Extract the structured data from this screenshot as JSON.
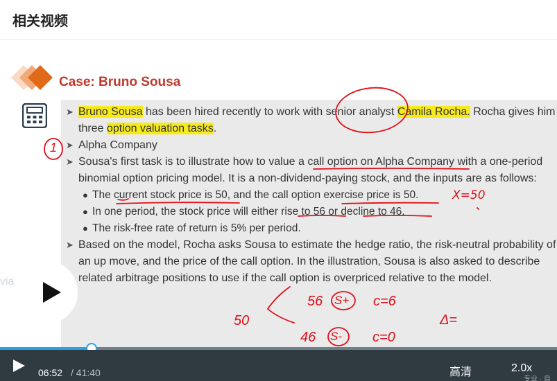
{
  "header": {
    "title": "相关视频"
  },
  "slide": {
    "title": "Case: Bruno Sousa",
    "lines": {
      "l1_hl1": "Bruno Sousa",
      "l1_mid": " has been hired recently to work with senior analyst ",
      "l1_hl2": "Camila Rocha.",
      "l1_end": " Rocha gives him",
      "l2_pre": "three ",
      "l2_hl": "option valuation tasks",
      "l2_end": ".",
      "l3": "Alpha Company",
      "l4": "Sousa's first task is to illustrate how to value a call option on Alpha Company with a one-period",
      "l5": "binomial option pricing model. It is a non-dividend-paying stock, and the inputs are as follows:",
      "b1": "The current stock price is 50, and the call option exercise price is 50.",
      "b2": "In one period, the stock price will either rise to 56 or decline to 46.",
      "b3": "The risk-free rate of return is 5% per period.",
      "l6": "Based on the model, Rocha asks Sousa to estimate the hedge ratio, the risk-neutral probability of",
      "l7": "an up move, and the price of the call option. In the illustration, Sousa is also asked to describe",
      "l8": "related arbitrage positions to use if the call option is overpriced relative to the model."
    },
    "annotations": {
      "x_eq": "X=50",
      "num50": "50",
      "num56": "56",
      "s_plus": "S+",
      "c_plus": "c=6",
      "num46": "46",
      "s_minus": "S-",
      "c_minus": "c=0",
      "delta": "Δ=",
      "circle_one": "1"
    },
    "side_text": "via"
  },
  "player": {
    "current_time": "06:52",
    "total_time": "/ 41:40",
    "progress_fraction": 0.165,
    "quality_label": "高清",
    "speed_label": "2.0x",
    "watermark": "专业 · 自"
  },
  "colors": {
    "highlight": "#f7ea1a",
    "slide_title": "#c0392b",
    "ink_red": "#e0101a",
    "progress": "#2b9fe8",
    "controls_bg": "#2f3a41"
  },
  "icons": [
    "diamond-logo-icon",
    "calculator-icon",
    "play-icon",
    "play-small-icon"
  ]
}
